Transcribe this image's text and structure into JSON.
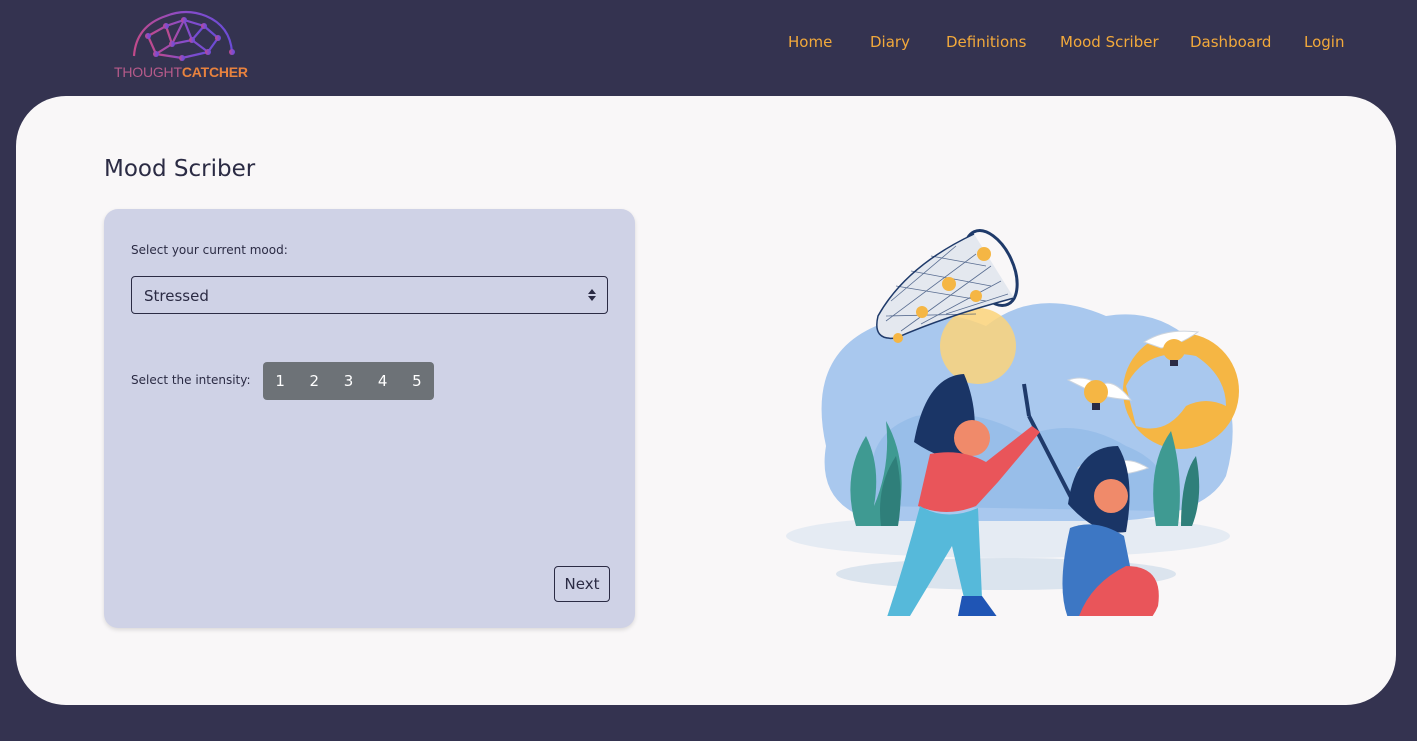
{
  "brand": {
    "name_part1": "THOUGHT",
    "name_part2": "CATCHER"
  },
  "nav": {
    "items": [
      "Home",
      "Diary",
      "Definitions",
      "Mood Scriber",
      "Dashboard",
      "Login"
    ]
  },
  "main": {
    "title": "Mood Scriber",
    "mood_label": "Select your current mood:",
    "mood_selected": "Stressed",
    "intensity_label": "Select the intensity:",
    "intensity_options": [
      "1",
      "2",
      "3",
      "4",
      "5"
    ],
    "next_label": "Next"
  },
  "icons": {
    "logo": "brain-network-logo",
    "select_caret": "sort-caret-icon",
    "illustration": "catching-ideas-illustration"
  },
  "colors": {
    "page_bg": "#343350",
    "nav_link": "#f2a93b",
    "card_bg": "#f9f7f8",
    "panel_bg": "#cfd2e6",
    "intensity_bg": "#6d7277",
    "text_dark": "#2b2b44"
  }
}
